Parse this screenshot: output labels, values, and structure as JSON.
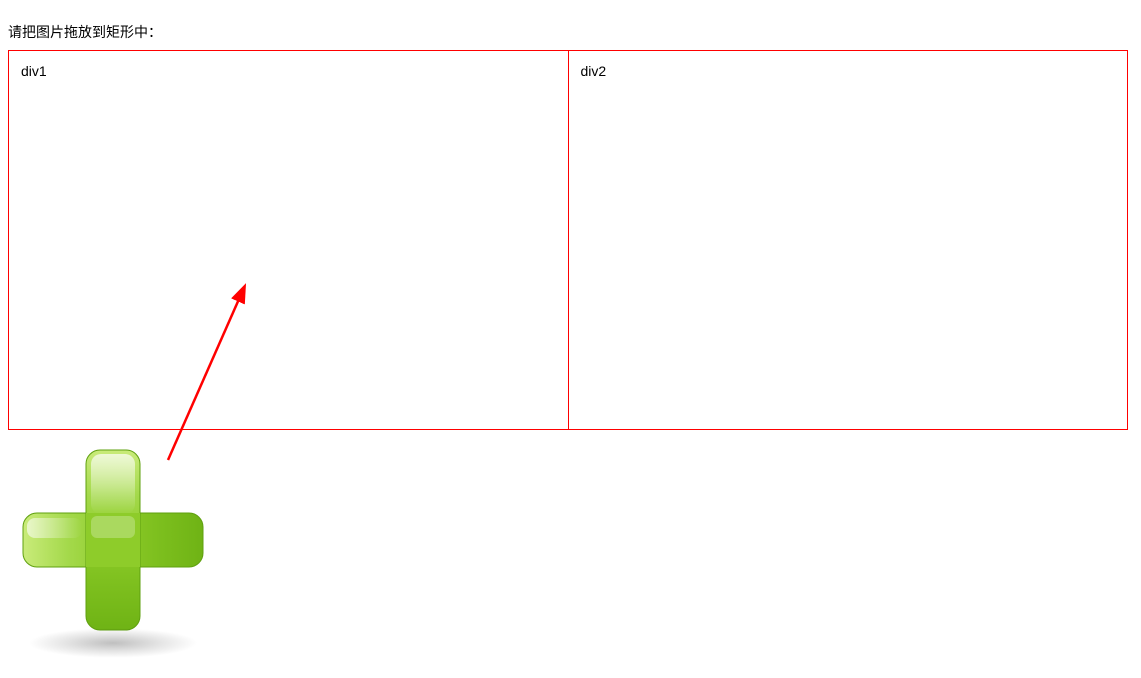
{
  "instruction": "请把图片拖放到矩形中：",
  "zones": {
    "left": "div1",
    "right": "div2"
  },
  "icon": {
    "name": "plus-icon",
    "color_light": "#b8e356",
    "color_mid": "#8ecc2a",
    "color_dark": "#6fb315"
  },
  "arrow": {
    "color": "#ff0000"
  }
}
